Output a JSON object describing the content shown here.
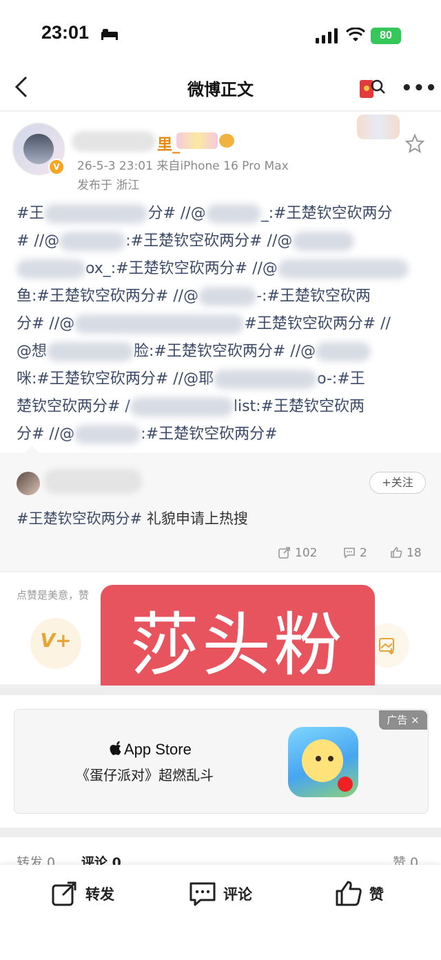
{
  "status_bar": {
    "time": "23:01",
    "battery": "80"
  },
  "nav": {
    "title": "微博正文"
  },
  "post": {
    "user_suffix": "里_",
    "timestamp": "26-5-3 23:01",
    "source": "来自iPhone 16 Pro Max",
    "location": "发布于 浙江",
    "lines": [
      [
        "#王",
        "",
        "分# //@",
        "",
        "_:#王楚钦空砍两分"
      ],
      [
        "# //@",
        "",
        ":#王楚钦空砍两分# //@",
        ""
      ],
      [
        "",
        "ox_:#王楚钦空砍两分# //@",
        ""
      ],
      [
        "鱼:#王楚钦空砍两分# //@",
        "",
        "-:#王楚钦空砍两"
      ],
      [
        "分# //@",
        "",
        "#王楚钦空砍两分# //"
      ],
      [
        "@想",
        "",
        "脸:#王楚钦空砍两分# //@",
        ""
      ],
      [
        "咪:#王楚钦空砍两分# //@耶",
        "",
        "o-:#王"
      ],
      [
        "楚钦空砍两分# /",
        "",
        "list:#王楚钦空砍两"
      ],
      [
        "分# //@",
        "",
        ":#王楚钦空砍两分#"
      ]
    ]
  },
  "repost": {
    "follow_label": "+关注",
    "hashtag": "#王楚钦空砍两分#",
    "text": "礼貌申请上热搜",
    "shares": "102",
    "comments": "2",
    "likes": "18"
  },
  "like_hint": "点赞是美意，赞",
  "overlay_text": "莎头粉",
  "ad": {
    "tag": "广告 ×",
    "store": "App Store",
    "line": "《蛋仔派对》超燃乱斗"
  },
  "tabs": {
    "repost": "转发 0",
    "comment": "评论 0",
    "like": "赞 0"
  },
  "bottom_bar": {
    "repost": "转发",
    "comment": "评论",
    "like": "赞"
  },
  "colors": {
    "hashtag": "#3c4a69",
    "overlay_bg": "#e7545d",
    "battery": "#35c759"
  }
}
